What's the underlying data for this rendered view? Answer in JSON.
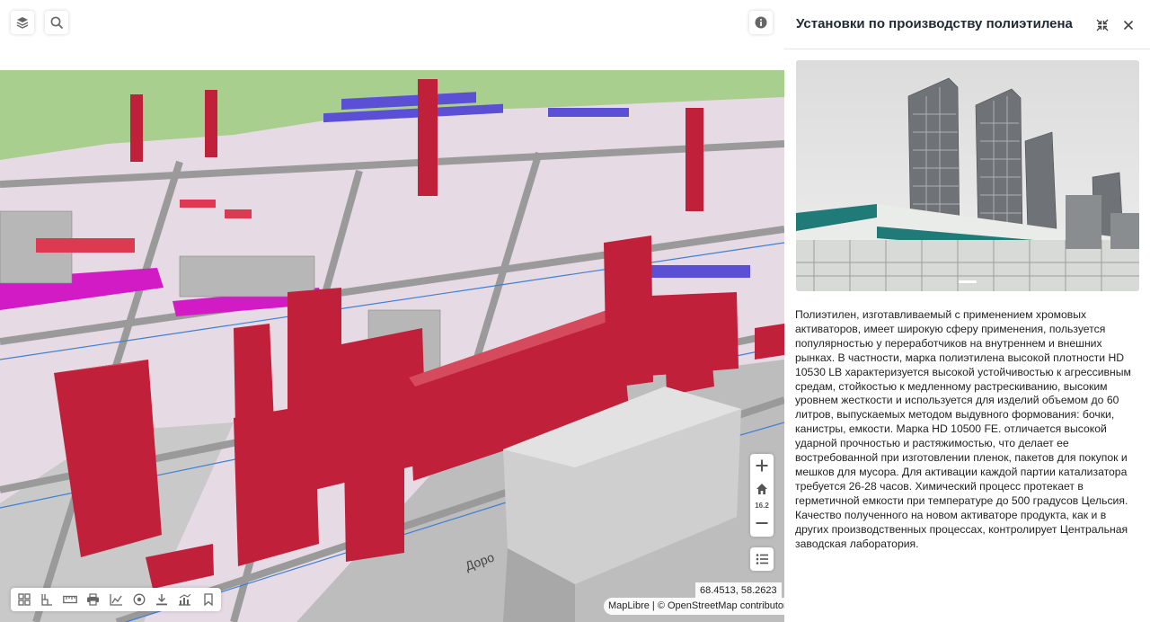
{
  "map": {
    "zoom_level": "16.2",
    "coordinates": "68.4513, 58.2623",
    "road_label": "Доро",
    "attribution": {
      "maplibre": "MapLibre",
      "separator": " | © ",
      "osm": "OpenStreetMap",
      "contributors": " contributors"
    },
    "controls": {
      "top_left": [
        "layers-icon",
        "search-icon"
      ],
      "top_right": [
        "info-icon"
      ],
      "zoom": [
        "zoom-in-icon",
        "home-icon",
        "zoom-out-icon"
      ],
      "legend": "legend-list-icon",
      "bottom_toolbar": [
        "grid-icon",
        "building-icon",
        "ruler-icon",
        "print-icon",
        "chart-icon",
        "location-icon",
        "download-icon",
        "analytics-icon",
        "bookmark-icon"
      ]
    },
    "colors": {
      "ground": "#e6dbe5",
      "grass": "#a9cf8e",
      "building_red": "#c0203a",
      "magenta": "#d21bc4",
      "gray_building": "#cfcfcf",
      "road_blue": "#3f7fd3"
    }
  },
  "panel": {
    "title": "Установки по производству полиэтилена",
    "collapse_icon": "collapse-icon",
    "close_icon": "close-icon",
    "photo_icon": "plant-photo",
    "description": "Полиэтилен, изготавливаемый с применением хромовых активаторов, имеет широкую сферу применения, пользуется популярностью у переработчиков на внутреннем и внешних рынках. В частности, марка полиэтилена высокой плотности HD 10530 LB характеризуется высокой устойчивостью к агрессивным средам, стойкостью к медленному растрескиванию, высоким уровнем жесткости и используется для изделий объемом до 60 литров, выпускаемых методом выдувного формования: бочки, канистры, емкости. Марка HD 10500 FE. отличается высокой ударной прочностью и растяжимостью, что делает ее востребованной при изготовлении пленок, пакетов для покупок и мешков для мусора. Для активации каждой партии катализатора требуется 26-28 часов. Химический процесс протекает в герметичной емкости при температуре до 500 градусов Цельсия. Качество полученного на новом активаторе продукта, как и в других производственных процессах, контролирует Центральная заводская лаборатория."
  }
}
